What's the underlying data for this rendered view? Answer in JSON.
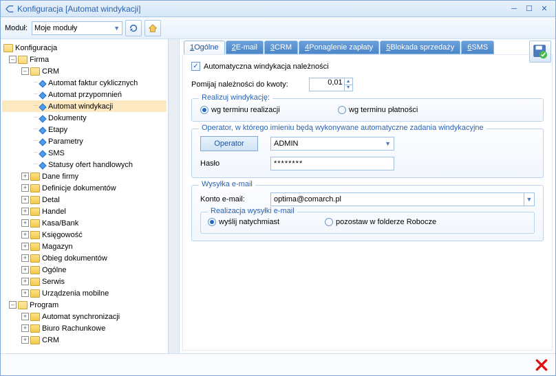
{
  "window": {
    "title": "Konfiguracja [Automat windykacji]"
  },
  "toolbar": {
    "module_label": "Moduł:",
    "module_value": "Moje moduły"
  },
  "tree": {
    "root": "Konfiguracja",
    "firma": "Firma",
    "crm": "CRM",
    "crm_items": [
      "Automat faktur cyklicznych",
      "Automat przypomnień",
      "Automat windykacji",
      "Dokumenty",
      "Etapy",
      "Parametry",
      "SMS",
      "Statusy ofert handlowych"
    ],
    "firma_items": [
      "Dane firmy",
      "Definicje dokumentów",
      "Detal",
      "Handel",
      "Kasa/Bank",
      "Księgowość",
      "Magazyn",
      "Obieg dokumentów",
      "Ogólne",
      "Serwis",
      "Urządzenia mobilne"
    ],
    "program": "Program",
    "program_items": [
      "Automat synchronizacji",
      "Biuro Rachunkowe",
      "CRM"
    ]
  },
  "tabs": {
    "t1": {
      "num": "1",
      "label": " Ogólne"
    },
    "t2": {
      "num": "2",
      "label": " E-mail"
    },
    "t3": {
      "num": "3",
      "label": " CRM"
    },
    "t4": {
      "num": "4",
      "label": " Ponaglenie zapłaty"
    },
    "t5": {
      "num": "5",
      "label": " Blokada sprzedaży"
    },
    "t6": {
      "num": "6",
      "label": " SMS"
    }
  },
  "form": {
    "auto_label": "Automatyczna windykacja należności",
    "skip_label": "Pomijaj należności do kwoty:",
    "skip_value": "0,01",
    "group_realizuj": "Realizuj windykację:",
    "radio_term_real": "wg terminu realizacji",
    "radio_term_plat": "wg terminu płatności",
    "group_operator": "Operator, w którego imieniu będą wykonywane automatyczne zadania windykacyjne",
    "operator_btn": "Operator",
    "operator_value": "ADMIN",
    "haslo_label": "Hasło",
    "haslo_value": "********",
    "group_email": "Wysyłka e-mail",
    "konto_label": "Konto e-mail:",
    "konto_value": "optima@comarch.pl",
    "group_email_real": "Realizacja wysyłki e-mail",
    "radio_now": "wyślij natychmiast",
    "radio_draft": "pozostaw w folderze Robocze"
  }
}
